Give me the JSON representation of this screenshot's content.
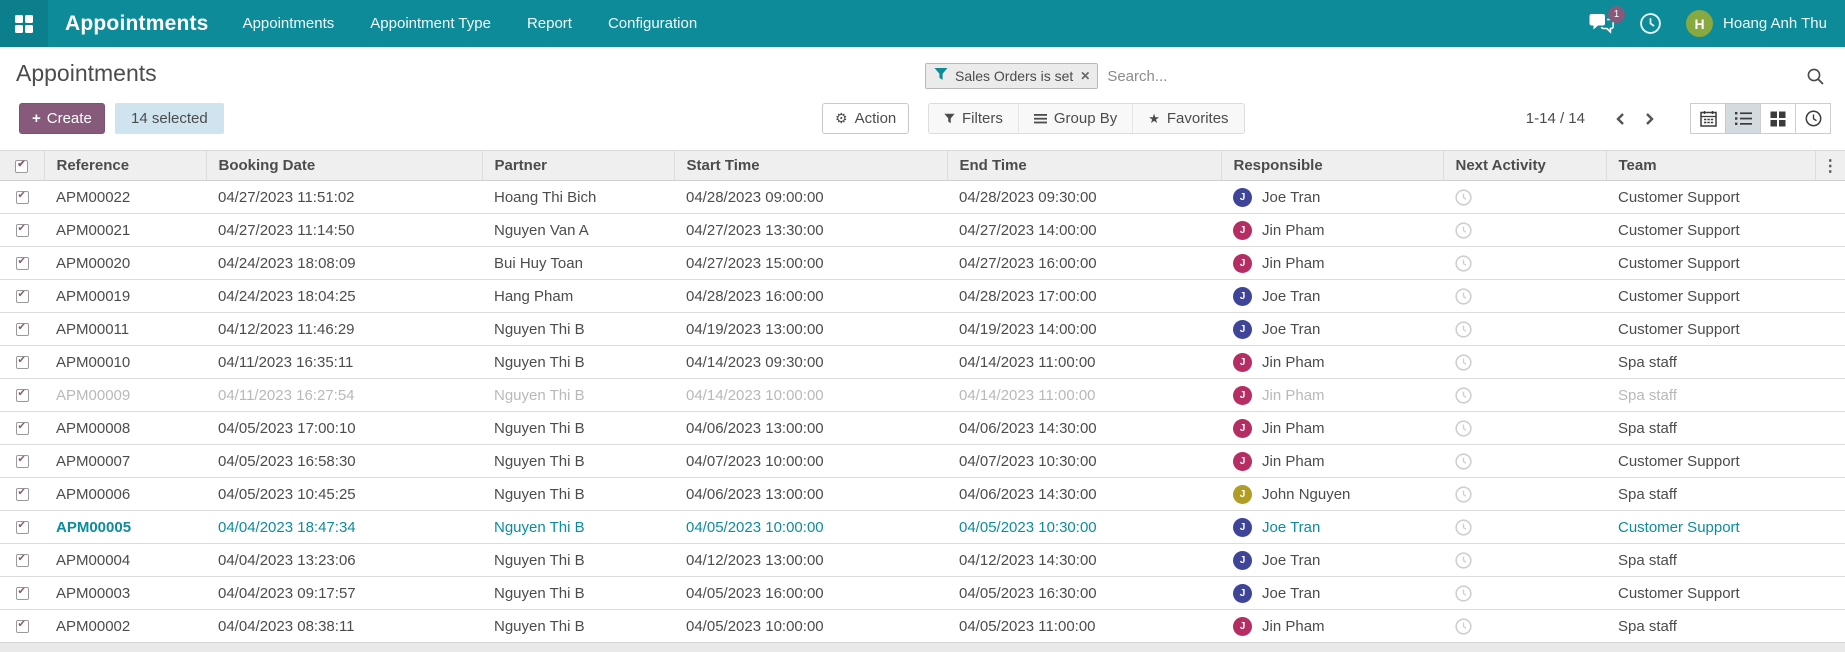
{
  "topbar": {
    "brand": "Appointments",
    "menus": [
      "Appointments",
      "Appointment Type",
      "Report",
      "Configuration"
    ],
    "message_badge": "1",
    "user_initial": "H",
    "user_name": "Hoang Anh Thu"
  },
  "control_panel": {
    "title": "Appointments",
    "create_label": "Create",
    "selected_label": "14 selected",
    "action_label": "Action",
    "search": {
      "facet": "Sales Orders is set",
      "placeholder": "Search..."
    },
    "filters_label": "Filters",
    "group_by_label": "Group By",
    "favorites_label": "Favorites",
    "pager": "1-14 / 14"
  },
  "table": {
    "columns": [
      "Reference",
      "Booking Date",
      "Partner",
      "Start Time",
      "End Time",
      "Responsible",
      "Next Activity",
      "Team"
    ],
    "rows": [
      {
        "reference": "APM00022",
        "booking_date": "04/27/2023 11:51:02",
        "partner": "Hoang Thi Bich",
        "start_time": "04/28/2023 09:00:00",
        "end_time": "04/28/2023 09:30:00",
        "responsible": "Joe Tran",
        "avatar_color": "#3e4498",
        "team": "Customer Support",
        "state": "normal"
      },
      {
        "reference": "APM00021",
        "booking_date": "04/27/2023 11:14:50",
        "partner": "Nguyen Van A",
        "start_time": "04/27/2023 13:30:00",
        "end_time": "04/27/2023 14:00:00",
        "responsible": "Jin Pham",
        "avatar_color": "#b52d62",
        "team": "Customer Support",
        "state": "normal"
      },
      {
        "reference": "APM00020",
        "booking_date": "04/24/2023 18:08:09",
        "partner": "Bui Huy Toan",
        "start_time": "04/27/2023 15:00:00",
        "end_time": "04/27/2023 16:00:00",
        "responsible": "Jin Pham",
        "avatar_color": "#b52d62",
        "team": "Customer Support",
        "state": "normal"
      },
      {
        "reference": "APM00019",
        "booking_date": "04/24/2023 18:04:25",
        "partner": "Hang Pham",
        "start_time": "04/28/2023 16:00:00",
        "end_time": "04/28/2023 17:00:00",
        "responsible": "Joe Tran",
        "avatar_color": "#3e4498",
        "team": "Customer Support",
        "state": "normal"
      },
      {
        "reference": "APM00011",
        "booking_date": "04/12/2023 11:46:29",
        "partner": "Nguyen Thi B",
        "start_time": "04/19/2023 13:00:00",
        "end_time": "04/19/2023 14:00:00",
        "responsible": "Joe Tran",
        "avatar_color": "#3e4498",
        "team": "Customer Support",
        "state": "normal"
      },
      {
        "reference": "APM00010",
        "booking_date": "04/11/2023 16:35:11",
        "partner": "Nguyen Thi B",
        "start_time": "04/14/2023 09:30:00",
        "end_time": "04/14/2023 11:00:00",
        "responsible": "Jin Pham",
        "avatar_color": "#b52d62",
        "team": "Spa staff",
        "state": "normal"
      },
      {
        "reference": "APM00009",
        "booking_date": "04/11/2023 16:27:54",
        "partner": "Nguyen Thi B",
        "start_time": "04/14/2023 10:00:00",
        "end_time": "04/14/2023 11:00:00",
        "responsible": "Jin Pham",
        "avatar_color": "#b52d62",
        "team": "Spa staff",
        "state": "muted"
      },
      {
        "reference": "APM00008",
        "booking_date": "04/05/2023 17:00:10",
        "partner": "Nguyen Thi B",
        "start_time": "04/06/2023 13:00:00",
        "end_time": "04/06/2023 14:30:00",
        "responsible": "Jin Pham",
        "avatar_color": "#b52d62",
        "team": "Spa staff",
        "state": "normal"
      },
      {
        "reference": "APM00007",
        "booking_date": "04/05/2023 16:58:30",
        "partner": "Nguyen Thi B",
        "start_time": "04/07/2023 10:00:00",
        "end_time": "04/07/2023 10:30:00",
        "responsible": "Jin Pham",
        "avatar_color": "#b52d62",
        "team": "Customer Support",
        "state": "normal"
      },
      {
        "reference": "APM00006",
        "booking_date": "04/05/2023 10:45:25",
        "partner": "Nguyen Thi B",
        "start_time": "04/06/2023 13:00:00",
        "end_time": "04/06/2023 14:30:00",
        "responsible": "John Nguyen",
        "avatar_color": "#b09d25",
        "team": "Spa staff",
        "state": "normal"
      },
      {
        "reference": "APM00005",
        "booking_date": "04/04/2023 18:47:34",
        "partner": "Nguyen Thi B",
        "start_time": "04/05/2023 10:00:00",
        "end_time": "04/05/2023 10:30:00",
        "responsible": "Joe Tran",
        "avatar_color": "#3e4498",
        "team": "Customer Support",
        "state": "highlight"
      },
      {
        "reference": "APM00004",
        "booking_date": "04/04/2023 13:23:06",
        "partner": "Nguyen Thi B",
        "start_time": "04/12/2023 13:00:00",
        "end_time": "04/12/2023 14:30:00",
        "responsible": "Joe Tran",
        "avatar_color": "#3e4498",
        "team": "Spa staff",
        "state": "normal"
      },
      {
        "reference": "APM00003",
        "booking_date": "04/04/2023 09:17:57",
        "partner": "Nguyen Thi B",
        "start_time": "04/05/2023 16:00:00",
        "end_time": "04/05/2023 16:30:00",
        "responsible": "Joe Tran",
        "avatar_color": "#3e4498",
        "team": "Customer Support",
        "state": "normal"
      },
      {
        "reference": "APM00002",
        "booking_date": "04/04/2023 08:38:11",
        "partner": "Nguyen Thi B",
        "start_time": "04/05/2023 10:00:00",
        "end_time": "04/05/2023 11:00:00",
        "responsible": "Jin Pham",
        "avatar_color": "#b52d62",
        "team": "Spa staff",
        "state": "normal"
      }
    ]
  },
  "colors": {
    "brand_teal": "#0d8b99",
    "primary_purple": "#875a7b",
    "highlight_teal": "#0d8c9d",
    "muted_text": "#b9b9b9",
    "selected_badge_bg": "#cfe4ee"
  }
}
